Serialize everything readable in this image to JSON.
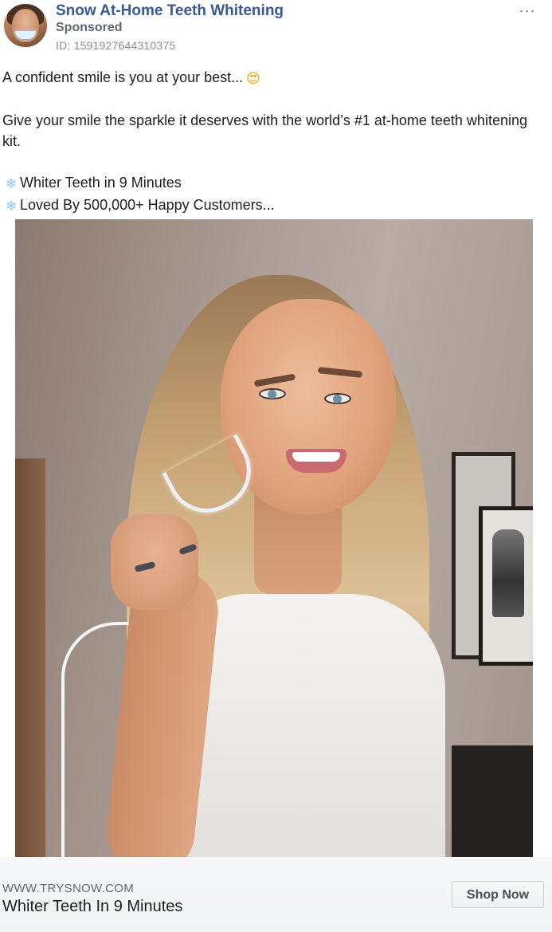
{
  "post": {
    "page_name": "Snow At-Home Teeth Whitening",
    "sponsored_label": "Sponsored",
    "ad_id": "ID: 1591927644310375",
    "more_menu_glyph": "···",
    "avatar_icon": "profile-avatar-icon"
  },
  "copy": {
    "line1": "A confident smile is you at your best...",
    "line1_emoji": "😍",
    "line2": "Give your smile the sparkle it deserves with the world’s #1 at-home teeth whitening kit.",
    "bullets": [
      {
        "emoji": "❄",
        "text": "Whiter Teeth in 9 Minutes"
      },
      {
        "emoji": "❄",
        "text": "Loved By 500,000+ Happy Customers..."
      }
    ]
  },
  "media": {
    "alt": "Woman smiling holding a clear whitening mouth tray"
  },
  "link": {
    "domain": "WWW.TRYSNOW.COM",
    "title": "Whiter Teeth In 9 Minutes",
    "cta_label": "Shop Now"
  },
  "colors": {
    "page_name": "#385898",
    "secondary_text": "#606770",
    "footer_bg": "#f2f3f5"
  }
}
